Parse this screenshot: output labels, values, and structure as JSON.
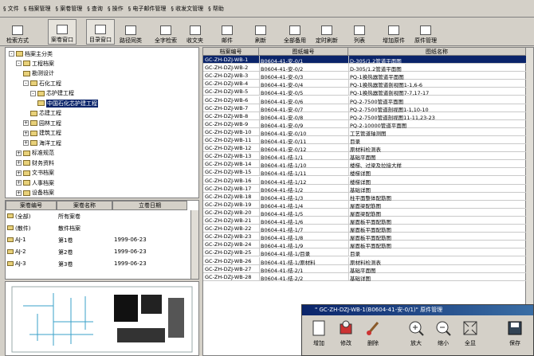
{
  "menu": [
    "§ 文件",
    "§ 档案管理",
    "§ 案卷管理",
    "§ 查询",
    "§ 操作",
    "§ 电子邮件管理",
    "§ 收发文管理",
    "§ 帮助"
  ],
  "toolbar": {
    "buttons": [
      "检索方式",
      "案卷窗口",
      "目录窗口",
      "路径同类",
      "全字检索",
      "收文夹",
      "邮件",
      "刷新",
      "全部备用",
      "定时刷新",
      "列表",
      "增加原件",
      "原件管理"
    ]
  },
  "tree": {
    "title": "档案主分类",
    "items": [
      {
        "label": "工程档案",
        "level": 1,
        "exp": "-"
      },
      {
        "label": "勘测设计",
        "level": 2,
        "exp": ""
      },
      {
        "label": "石化工程",
        "level": 2,
        "exp": "-"
      },
      {
        "label": "芯护建工程",
        "level": 3,
        "exp": "-"
      },
      {
        "label": "中国石化芯护建工程",
        "level": 4,
        "exp": "",
        "selected": true
      },
      {
        "label": "芯建工程",
        "level": 3,
        "exp": ""
      },
      {
        "label": "园林工程",
        "level": 2,
        "exp": "+"
      },
      {
        "label": "建筑工程",
        "level": 2,
        "exp": "+"
      },
      {
        "label": "海洋工程",
        "level": 2,
        "exp": "+"
      },
      {
        "label": "标准规范",
        "level": 1,
        "exp": "+"
      },
      {
        "label": "财务资料",
        "level": 1,
        "exp": "+"
      },
      {
        "label": "文书档案",
        "level": 1,
        "exp": "+"
      },
      {
        "label": "人事档案",
        "level": 1,
        "exp": "+"
      },
      {
        "label": "设备档案",
        "level": 1,
        "exp": "+"
      }
    ]
  },
  "caselist": {
    "headers": [
      "案卷编号",
      "案卷名称",
      "立卷日期"
    ],
    "rows": [
      [
        "(全部)",
        "所有案卷",
        ""
      ],
      [
        "(散件)",
        "散件档案",
        ""
      ],
      [
        "AJ-1",
        "第1卷",
        "1999-06-23"
      ],
      [
        "AJ-2",
        "第2卷",
        "1999-06-23"
      ],
      [
        "AJ-3",
        "第3卷",
        "1999-06-23"
      ]
    ]
  },
  "grid": {
    "headers": [
      "档案编号",
      "图纸编号",
      "图纸名称"
    ],
    "rows": [
      [
        "GC-ZH-DZJ-WB-1",
        "B0604-41-安-0/1",
        "D-305/1.2管道平面图"
      ],
      [
        "GC-ZH-DZJ-WB-2",
        "B0604-41-安-0/2",
        "D-305/1.2管道平面图"
      ],
      [
        "GC-ZH-DZJ-WB-3",
        "B0604-41-安-0/3",
        "PQ-1换热器管道平面图"
      ],
      [
        "GC-ZH-DZJ-WB-4",
        "B0604-41-安-0/4",
        "PQ-1换热器管道剖视图1-1,6-6"
      ],
      [
        "GC-ZH-DZJ-WB-5",
        "B0604-41-安-0/5",
        "PQ-1换热器管道剖视图7-7,17-17"
      ],
      [
        "GC-ZH-DZJ-WB-6",
        "B0604-41-安-0/6",
        "PQ-2-7500管道平面图"
      ],
      [
        "GC-ZH-DZJ-WB-7",
        "B0604-41-安-0/7",
        "PQ-2-7500管道剖视图1-1,10-10"
      ],
      [
        "GC-ZH-DZJ-WB-8",
        "B0604-41-安-0/8",
        "PQ-2-7500管道剖视图11-11,23-23"
      ],
      [
        "GC-ZH-DZJ-WB-9",
        "B0604-41-安-0/9",
        "PQ-2-10000管道平面图"
      ],
      [
        "GC-ZH-DZJ-WB-10",
        "B0604-41-安-0/10",
        "工艺管道轴测图"
      ],
      [
        "GC-ZH-DZJ-WB-11",
        "B0604-41-安-0/11",
        "目录"
      ],
      [
        "GC-ZH-DZJ-WB-12",
        "B0604-41-安-0/12",
        "原材料检测表"
      ],
      [
        "GC-ZH-DZJ-WB-13",
        "B0604-41-结-1/1",
        "基础平面图"
      ],
      [
        "GC-ZH-DZJ-WB-14",
        "B0604-41-结-1/10",
        "楼梯、过梁及拉接大样"
      ],
      [
        "GC-ZH-DZJ-WB-15",
        "B0604-41-结-1/11",
        "楼梯详图"
      ],
      [
        "GC-ZH-DZJ-WB-16",
        "B0604-41-结-1/12",
        "楼梯详图"
      ],
      [
        "GC-ZH-DZJ-WB-17",
        "B0604-41-结-1/2",
        "基础详图"
      ],
      [
        "GC-ZH-DZJ-WB-18",
        "B0604-41-结-1/3",
        "柱平面整体配筋图"
      ],
      [
        "GC-ZH-DZJ-WB-19",
        "B0604-41-结-1/4",
        "屋面梁配筋图"
      ],
      [
        "GC-ZH-DZJ-WB-20",
        "B0604-41-结-1/5",
        "屋面梁配筋图"
      ],
      [
        "GC-ZH-DZJ-WB-21",
        "B0604-41-结-1/6",
        "屋面板平面配筋图"
      ],
      [
        "GC-ZH-DZJ-WB-22",
        "B0604-41-结-1/7",
        "屋面板平面配筋图"
      ],
      [
        "GC-ZH-DZJ-WB-23",
        "B0604-41-结-1/8",
        "屋面板平面配筋图"
      ],
      [
        "GC-ZH-DZJ-WB-24",
        "B0604-41-结-1/9",
        "屋面板平面配筋图"
      ],
      [
        "GC-ZH-DZJ-WB-25",
        "B0604-41-结-1/目录",
        "目录"
      ],
      [
        "GC-ZH-DZJ-WB-26",
        "B0604-41-结-1/原材料",
        "原材料检测表"
      ],
      [
        "GC-ZH-DZJ-WB-27",
        "B0604-41-结-2/1",
        "基础平面图"
      ],
      [
        "GC-ZH-DZJ-WB-28",
        "B0604-41-结-2/2",
        "基础详图"
      ]
    ]
  },
  "popup": {
    "title": "\" GC-ZH-DZJ-WB-1(B0604-41-安-0/1)\" 原件管理",
    "buttons": [
      "增加",
      "修改",
      "删除",
      "放大",
      "缩小",
      "全显",
      "保存"
    ]
  }
}
